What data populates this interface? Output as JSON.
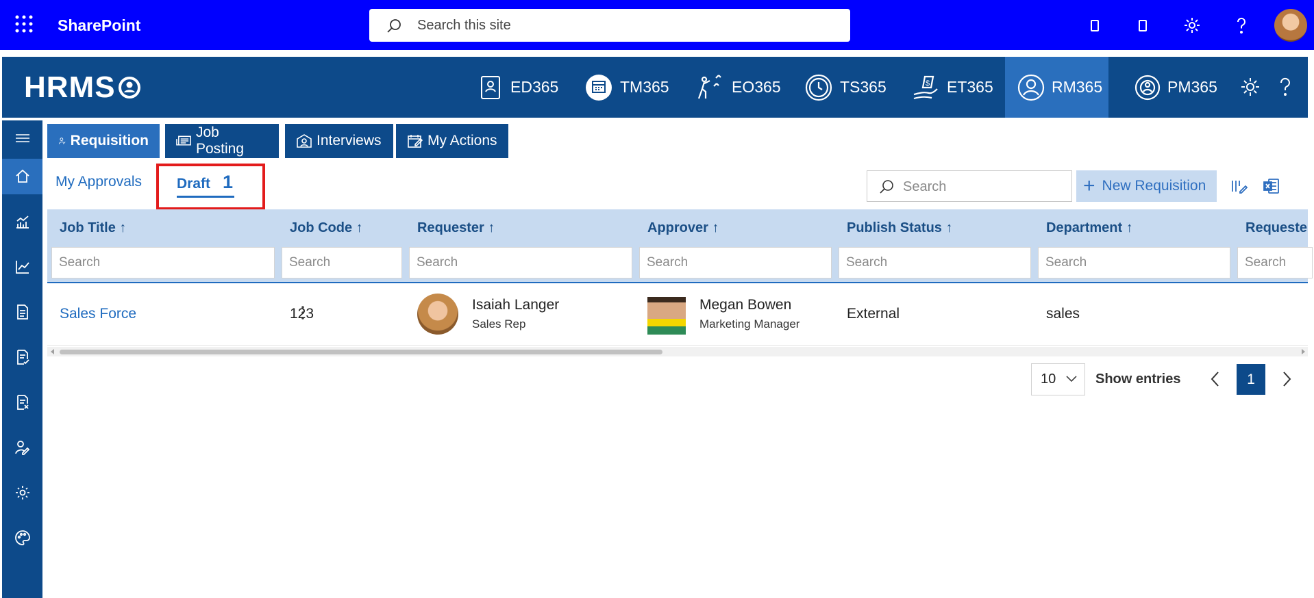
{
  "suitebar": {
    "app_name": "SharePoint",
    "search_placeholder": "Search this site",
    "icons": [
      "waffle-icon",
      "device-icon",
      "device-icon-2",
      "settings-gear-icon",
      "help-icon",
      "user-avatar"
    ]
  },
  "header": {
    "logo_text": "HRMS",
    "modules": [
      {
        "label": "ED365",
        "icon": "employee-directory-icon",
        "active": false
      },
      {
        "label": "TM365",
        "icon": "calendar-icon",
        "active": false
      },
      {
        "label": "EO365",
        "icon": "onboarding-icon",
        "active": false
      },
      {
        "label": "TS365",
        "icon": "clock-icon",
        "active": false
      },
      {
        "label": "ET365",
        "icon": "expense-icon",
        "active": false
      },
      {
        "label": "RM365",
        "icon": "recruit-person-icon",
        "active": true
      },
      {
        "label": "PM365",
        "icon": "performance-icon",
        "active": false
      }
    ]
  },
  "sidebar": {
    "items": [
      "menu-icon",
      "home-icon",
      "analytics-icon",
      "line-chart-icon",
      "document-icon",
      "document-check-icon",
      "document-x-icon",
      "person-edit-icon",
      "settings-icon",
      "palette-icon"
    ],
    "active_index": 1
  },
  "top_tabs": [
    {
      "label": "Requisition",
      "active": true
    },
    {
      "label": "Job Posting",
      "active": false
    },
    {
      "label": "Interviews",
      "active": false
    },
    {
      "label": "My Actions",
      "active": false
    }
  ],
  "sub_tabs": {
    "my_approvals": "My Approvals",
    "draft": "Draft",
    "draft_count": "1"
  },
  "toolbar": {
    "search_placeholder": "Search",
    "new_button": "New Requisition"
  },
  "table": {
    "columns": [
      "Job Title ↑",
      "Job Code ↑",
      "Requester ↑",
      "Approver ↑",
      "Publish Status ↑",
      "Department ↑",
      "Requeste"
    ],
    "filter_placeholder": "Search",
    "rows": [
      {
        "job_title": "Sales Force",
        "job_code": "123",
        "requester_name": "Isaiah Langer",
        "requester_role": "Sales Rep",
        "approver_name": "Megan Bowen",
        "approver_role": "Marketing Manager",
        "publish_status": "External",
        "department": "sales"
      }
    ]
  },
  "pagination": {
    "page_size": "10",
    "show_entries": "Show entries",
    "current_page": "1"
  },
  "colors": {
    "suitebar": "#0000ff",
    "header": "#0d4a8a",
    "active": "#2a6fbd",
    "grid_header": "#c7daf0",
    "link": "#1f6bbf",
    "highlight_box": "#e31b1b"
  }
}
